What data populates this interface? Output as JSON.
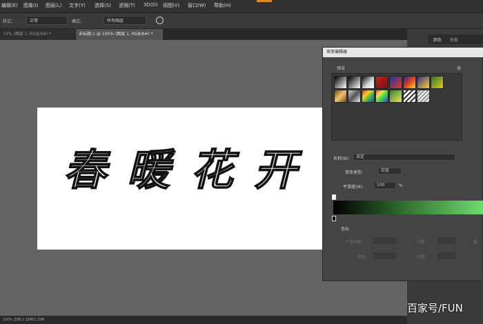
{
  "menu": {
    "items": [
      {
        "label": "编辑(E)"
      },
      {
        "label": "图像(I)"
      },
      {
        "label": "图层(L)"
      },
      {
        "label": "文字(Y)"
      },
      {
        "label": "选择(S)"
      },
      {
        "label": "滤镜(T)"
      },
      {
        "label": "3D(D)"
      },
      {
        "label": "视图(V)"
      },
      {
        "label": "窗口(W)"
      },
      {
        "label": "帮助(H)"
      }
    ]
  },
  "options": {
    "style_label": "样式:",
    "style_value": "正常",
    "blend_label": "模式:",
    "blend_value": "所有图层"
  },
  "tabs": [
    {
      "label": "74% (图层 1, RGB/8#) *"
    },
    {
      "label": "未标题-1 @ 100% (图层 1, RGB/8#) *"
    }
  ],
  "canvas": {
    "text": "春暖花开"
  },
  "status": "100% 文档:1.15M/1.15M",
  "panel": {
    "tab1": "颜色",
    "tab2": "色板"
  },
  "dialog": {
    "title": "渐变编辑器",
    "presets_label": "预设",
    "name_label": "名称(N):",
    "name_value": "自定",
    "type_label": "渐变类型:",
    "type_value": "实底",
    "smooth_label": "平滑度(M):",
    "smooth_value": "100",
    "smooth_unit": "%",
    "stops_label": "色标",
    "opacity_label": "不透明度:",
    "location_label": "位置:",
    "color_label": "颜色:",
    "location2_label": "位置:",
    "delete_label": "删"
  },
  "watermark": "百家号/FUN",
  "colors": {
    "accent": "#e28a1c",
    "gradient_start": "#000000",
    "gradient_end": "#6fdc6f"
  }
}
